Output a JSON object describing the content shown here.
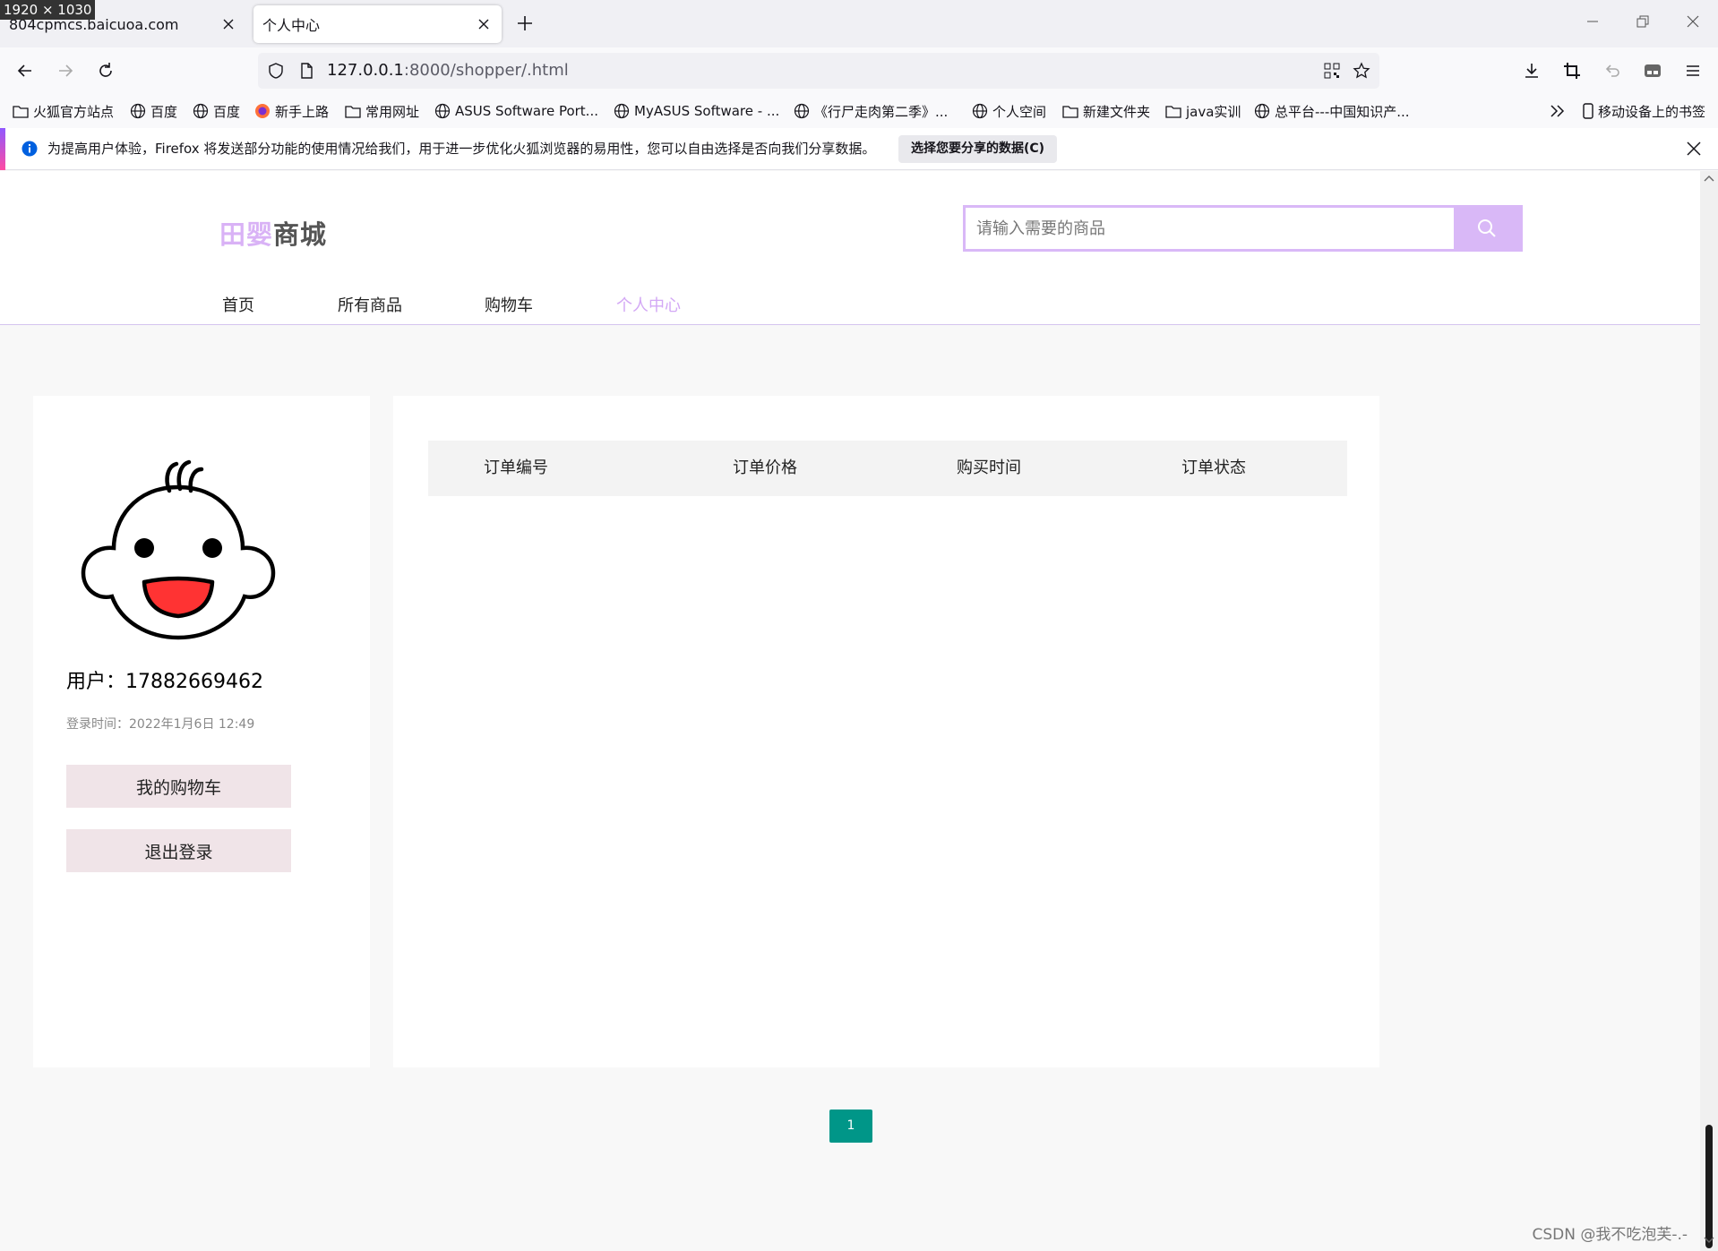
{
  "browser": {
    "dimension_badge": "1920 × 1030",
    "tabs": [
      {
        "title": "804cpmcs.baicuoa.com",
        "active": false
      },
      {
        "title": "个人中心",
        "active": true
      }
    ],
    "url_host": "127.0.0.1",
    "url_path": ":8000/shopper/.html",
    "bookmarks": [
      {
        "label": "火狐官方站点",
        "icon": "folder-icon"
      },
      {
        "label": "百度",
        "icon": "globe-icon"
      },
      {
        "label": "百度",
        "icon": "globe-icon"
      },
      {
        "label": "新手上路",
        "icon": "firefox-icon"
      },
      {
        "label": "常用网址",
        "icon": "folder-icon"
      },
      {
        "label": "ASUS Software Port...",
        "icon": "globe-icon"
      },
      {
        "label": "MyASUS Software - ...",
        "icon": "globe-icon"
      },
      {
        "label": "《行尸走肉第二季》...",
        "icon": "globe-icon"
      },
      {
        "label": "个人空间",
        "icon": "globe-icon"
      },
      {
        "label": "新建文件夹",
        "icon": "folder-icon"
      },
      {
        "label": "java实训",
        "icon": "folder-icon"
      },
      {
        "label": "总平台---中国知识产...",
        "icon": "globe-icon"
      }
    ],
    "mobile_bookmarks": "移动设备上的书签",
    "notification": {
      "text": "为提高用户体验，Firefox 将发送部分功能的使用情况给我们，用于进一步优化火狐浏览器的易用性，您可以自由选择是否向我们分享数据。",
      "button": "选择您要分享的数据(C)"
    }
  },
  "site": {
    "logo_part1": "田婴",
    "logo_part2": "商城",
    "search_placeholder": "请输入需要的商品",
    "nav": [
      {
        "label": "首页",
        "active": false
      },
      {
        "label": "所有商品",
        "active": false
      },
      {
        "label": "购物车",
        "active": false
      },
      {
        "label": "个人中心",
        "active": true
      }
    ],
    "accent_color": "#d9b8f7"
  },
  "profile": {
    "username": "用户：17882669462",
    "login_time": "登录时间：2022年1月6日 12:49",
    "cart_button": "我的购物车",
    "logout_button": "退出登录"
  },
  "orders": {
    "columns": [
      "订单编号",
      "订单价格",
      "购买时间",
      "订单状态"
    ],
    "rows": []
  },
  "pagination": {
    "current_page": "1"
  },
  "watermark": "CSDN @我不吃泡芙-.-"
}
